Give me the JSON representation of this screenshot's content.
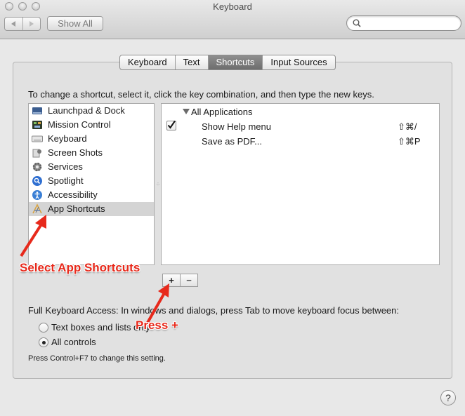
{
  "window": {
    "title": "Keyboard"
  },
  "toolbar": {
    "show_all_label": "Show All",
    "search": {
      "value": "",
      "placeholder": ""
    }
  },
  "tabs": [
    {
      "label": "Keyboard",
      "active": false
    },
    {
      "label": "Text",
      "active": false
    },
    {
      "label": "Shortcuts",
      "active": true
    },
    {
      "label": "Input Sources",
      "active": false
    }
  ],
  "instructions": "To change a shortcut, select it, click the key combination, and then type the new keys.",
  "categories": [
    {
      "label": "Launchpad & Dock",
      "icon": "launchpad-icon"
    },
    {
      "label": "Mission Control",
      "icon": "mission-control-icon"
    },
    {
      "label": "Keyboard",
      "icon": "keyboard-icon"
    },
    {
      "label": "Screen Shots",
      "icon": "screenshot-icon"
    },
    {
      "label": "Services",
      "icon": "gear-icon"
    },
    {
      "label": "Spotlight",
      "icon": "spotlight-icon"
    },
    {
      "label": "Accessibility",
      "icon": "accessibility-icon"
    },
    {
      "label": "App Shortcuts",
      "icon": "app-shortcuts-icon",
      "selected": true
    }
  ],
  "shortcuts": {
    "group_label": "All Applications",
    "items": [
      {
        "label": "Show Help menu",
        "keys": "⇧⌘/",
        "checked": true
      },
      {
        "label": "Save as PDF...",
        "keys": "⇧⌘P",
        "checked": null
      }
    ]
  },
  "buttons": {
    "add": "+",
    "remove": "−"
  },
  "full_keyboard_access": {
    "label": "Full Keyboard Access: In windows and dialogs, press Tab to move keyboard focus between:",
    "options": [
      {
        "label": "Text boxes and lists only",
        "selected": false
      },
      {
        "label": "All controls",
        "selected": true
      }
    ],
    "note": "Press Control+F7 to change this setting."
  },
  "help": {
    "label": "?"
  },
  "annotations": {
    "select_app_shortcuts": "Select App Shortcuts",
    "press_plus": "Press +"
  },
  "colors": {
    "annotation": "#e7291b",
    "selected_row": "#d4d4d4",
    "active_tab": "#7b7b7b"
  }
}
